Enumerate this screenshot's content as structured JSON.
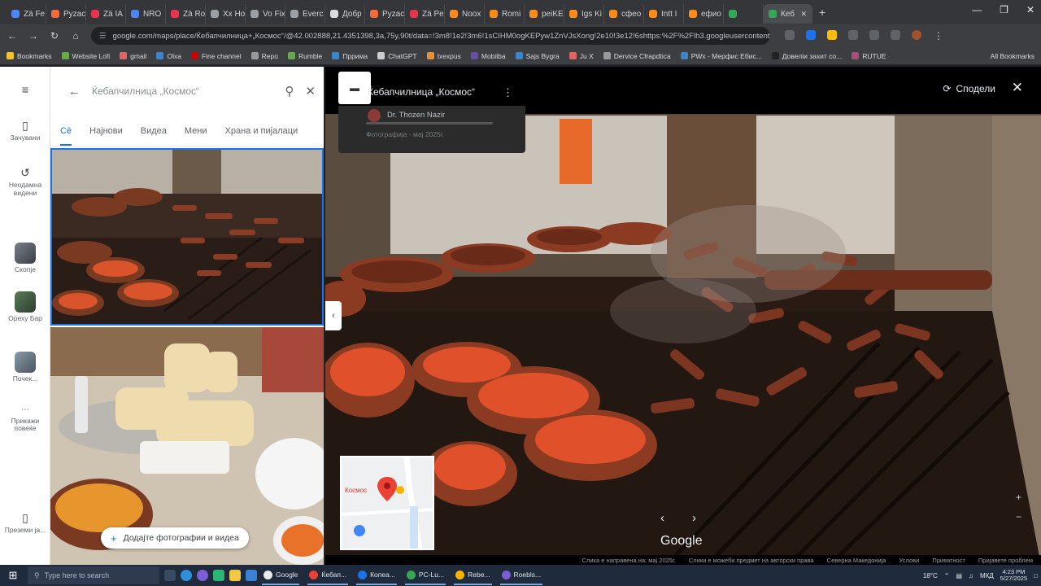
{
  "browser": {
    "tabs": [
      {
        "label": "Zä Fe",
        "color": "#4f86f7"
      },
      {
        "label": "Pyzac",
        "color": "#f46b3b"
      },
      {
        "label": "Zä IA",
        "color": "#e8344e"
      },
      {
        "label": "NRO",
        "color": "#4f86f7"
      },
      {
        "label": "Zä Ro",
        "color": "#e8344e"
      },
      {
        "label": "Xx Ho",
        "color": "#9aa0a6"
      },
      {
        "label": "Vo Fix",
        "color": "#9aa0a6"
      },
      {
        "label": "Everc",
        "color": "#9aa0a6"
      },
      {
        "label": "Добр",
        "color": "#dadce0"
      },
      {
        "label": "Pyzac",
        "color": "#f46b3b"
      },
      {
        "label": "Zä Pe",
        "color": "#e8344e"
      },
      {
        "label": "Noox",
        "color": "#ff8c1a"
      },
      {
        "label": "Romi",
        "color": "#ff8c1a"
      },
      {
        "label": "peiKE",
        "color": "#ff8c1a"
      },
      {
        "label": "Igs Ki",
        "color": "#ff8c1a"
      },
      {
        "label": "сфео",
        "color": "#ff8c1a"
      },
      {
        "label": "Intt I",
        "color": "#ff8c1a"
      },
      {
        "label": "ефио",
        "color": "#ff8c1a"
      },
      {
        "label": "",
        "color": "#34a853"
      },
      {
        "label": "Кеб",
        "color": "#34a853"
      }
    ],
    "new_tab": "+",
    "url": "google.com/maps/place/Ќебапчилница+„Космос“/@42.002888,21.4351398,3a,75y,90t/data=!3m8!1e2!3m6!1sCIHM0ogKEPyw1ZnVJsXong!2e10!3e12!6shttps:%2F%2Flh3.googleusercontent.com",
    "bookmarks": [
      {
        "label": "Bookmarks",
        "color": "#f1c232"
      },
      {
        "label": "Website Lofi",
        "color": "#6aa84f"
      },
      {
        "label": "gmail",
        "color": "#e06666"
      },
      {
        "label": "Olxa",
        "color": "#3d85c6"
      },
      {
        "label": "Fine channel",
        "color": "#cc0000"
      },
      {
        "label": "Repo",
        "color": "#999999"
      },
      {
        "label": "Rumble",
        "color": "#6aa84f"
      },
      {
        "label": "Пррима",
        "color": "#3d85c6"
      },
      {
        "label": "ChatGPT",
        "color": "#cccccc"
      },
      {
        "label": "Ixexpus",
        "color": "#e69138"
      },
      {
        "label": "Mobilba",
        "color": "#674ea7"
      },
      {
        "label": "Sajs Bygra",
        "color": "#3d85c6"
      },
      {
        "label": "Ju X",
        "color": "#e06666"
      },
      {
        "label": "Dervice Cfrapdtica",
        "color": "#999999"
      },
      {
        "label": "PWx - Мерфис Ебис...",
        "color": "#3d85c6"
      },
      {
        "label": "Довелiи захит со...",
        "color": "#222222"
      },
      {
        "label": "RUTUE",
        "color": "#a64d79"
      }
    ],
    "all_bookmarks": "All Bookmarks"
  },
  "maps": {
    "rail": {
      "menu": "≡",
      "saved": "Зачувани",
      "recent": "Неодамна видени",
      "place_1": "Скопје",
      "place_2": "Ореху Бар",
      "place_3": "Почек...",
      "more": "Прикажи повеќе",
      "app": "Преземи ја..."
    },
    "panel": {
      "title": "Ќебапчилница „Космос“",
      "chips": [
        "Сè",
        "Најнови",
        "Видеа",
        "Мени",
        "Храна и пијалаци"
      ],
      "add_photos": "Додајте фотографии и видеа"
    },
    "viewer": {
      "title": "Ќебапчилница „Космос“",
      "author": "Dr. Thozen Nazir",
      "date": "Фотографија - мај 2025г.",
      "share": "Сподели",
      "map_label": "Космос",
      "watermark": "Google",
      "footer": [
        "Слика е направена на: мај 2025г.",
        "Слики е можеби предмет на авторски права",
        "Северна Македонија",
        "Услови",
        "Приватност",
        "Пријавете проблем"
      ]
    }
  },
  "taskbar": {
    "search_placeholder": "Type here to search",
    "apps": [
      "Google",
      "Ќебап...",
      "Копеа...",
      "PC-Lu...",
      "Rebe...",
      "Roebls..."
    ],
    "weather": "18°C",
    "lang": "МКД",
    "time": "4:23 PM",
    "date": "5/27/2025"
  }
}
